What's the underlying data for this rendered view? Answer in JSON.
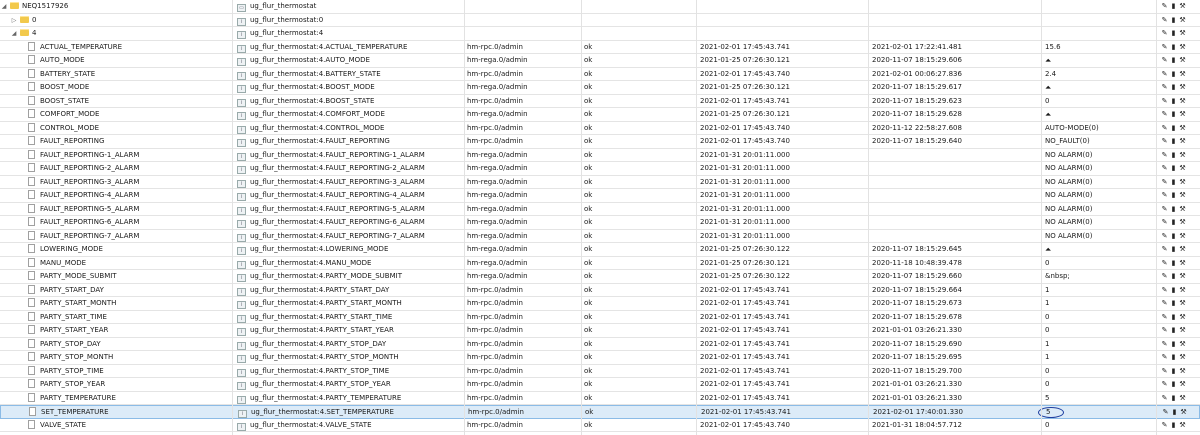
{
  "tree": {
    "root": {
      "name": "NEQ1517926",
      "title": "ug_flur_thermostat"
    },
    "channel0": {
      "name": "0",
      "title": "ug_flur_thermostat:0"
    },
    "channel4": {
      "name": "4",
      "title": "ug_flur_thermostat:4"
    },
    "states": [
      {
        "name": "ACTUAL_TEMPERATURE",
        "title": "ug_flur_thermostat:4.ACTUAL_TEMPERATURE",
        "role": "hm-rpc.0/admin",
        "ack": "ok",
        "ts": "2021-02-01 17:45:43.741",
        "lc": "2021-02-01 17:22:41.481",
        "value": "15.6"
      },
      {
        "name": "AUTO_MODE",
        "title": "ug_flur_thermostat:4.AUTO_MODE",
        "role": "hm-rega.0/admin",
        "ack": "ok",
        "ts": "2021-01-25 07:26:30.121",
        "lc": "2020-11-07 18:15:29.606",
        "value": "",
        "icon": "button-icon"
      },
      {
        "name": "BATTERY_STATE",
        "title": "ug_flur_thermostat:4.BATTERY_STATE",
        "role": "hm-rpc.0/admin",
        "ack": "ok",
        "ts": "2021-02-01 17:45:43.740",
        "lc": "2021-02-01 00:06:27.836",
        "value": "2.4"
      },
      {
        "name": "BOOST_MODE",
        "title": "ug_flur_thermostat:4.BOOST_MODE",
        "role": "hm-rega.0/admin",
        "ack": "ok",
        "ts": "2021-01-25 07:26:30.121",
        "lc": "2020-11-07 18:15:29.617",
        "value": "",
        "icon": "button-icon"
      },
      {
        "name": "BOOST_STATE",
        "title": "ug_flur_thermostat:4.BOOST_STATE",
        "role": "hm-rpc.0/admin",
        "ack": "ok",
        "ts": "2021-02-01 17:45:43.741",
        "lc": "2020-11-07 18:15:29.623",
        "value": "0"
      },
      {
        "name": "COMFORT_MODE",
        "title": "ug_flur_thermostat:4.COMFORT_MODE",
        "role": "hm-rega.0/admin",
        "ack": "ok",
        "ts": "2021-01-25 07:26:30.121",
        "lc": "2020-11-07 18:15:29.628",
        "value": "",
        "icon": "button-icon"
      },
      {
        "name": "CONTROL_MODE",
        "title": "ug_flur_thermostat:4.CONTROL_MODE",
        "role": "hm-rpc.0/admin",
        "ack": "ok",
        "ts": "2021-02-01 17:45:43.740",
        "lc": "2020-11-12 22:58:27.608",
        "value": "AUTO-MODE(0)"
      },
      {
        "name": "FAULT_REPORTING",
        "title": "ug_flur_thermostat:4.FAULT_REPORTING",
        "role": "hm-rpc.0/admin",
        "ack": "ok",
        "ts": "2021-02-01 17:45:43.740",
        "lc": "2020-11-07 18:15:29.640",
        "value": "NO_FAULT(0)"
      },
      {
        "name": "FAULT_REPORTING-1_ALARM",
        "title": "ug_flur_thermostat:4.FAULT_REPORTING-1_ALARM",
        "role": "hm-rega.0/admin",
        "ack": "ok",
        "ts": "2021-01-31 20:01:11.000",
        "lc": "",
        "value": "NO ALARM(0)"
      },
      {
        "name": "FAULT_REPORTING-2_ALARM",
        "title": "ug_flur_thermostat:4.FAULT_REPORTING-2_ALARM",
        "role": "hm-rega.0/admin",
        "ack": "ok",
        "ts": "2021-01-31 20:01:11.000",
        "lc": "",
        "value": "NO ALARM(0)"
      },
      {
        "name": "FAULT_REPORTING-3_ALARM",
        "title": "ug_flur_thermostat:4.FAULT_REPORTING-3_ALARM",
        "role": "hm-rega.0/admin",
        "ack": "ok",
        "ts": "2021-01-31 20:01:11.000",
        "lc": "",
        "value": "NO ALARM(0)"
      },
      {
        "name": "FAULT_REPORTING-4_ALARM",
        "title": "ug_flur_thermostat:4.FAULT_REPORTING-4_ALARM",
        "role": "hm-rega.0/admin",
        "ack": "ok",
        "ts": "2021-01-31 20:01:11.000",
        "lc": "",
        "value": "NO ALARM(0)"
      },
      {
        "name": "FAULT_REPORTING-5_ALARM",
        "title": "ug_flur_thermostat:4.FAULT_REPORTING-5_ALARM",
        "role": "hm-rega.0/admin",
        "ack": "ok",
        "ts": "2021-01-31 20:01:11.000",
        "lc": "",
        "value": "NO ALARM(0)"
      },
      {
        "name": "FAULT_REPORTING-6_ALARM",
        "title": "ug_flur_thermostat:4.FAULT_REPORTING-6_ALARM",
        "role": "hm-rega.0/admin",
        "ack": "ok",
        "ts": "2021-01-31 20:01:11.000",
        "lc": "",
        "value": "NO ALARM(0)"
      },
      {
        "name": "FAULT_REPORTING-7_ALARM",
        "title": "ug_flur_thermostat:4.FAULT_REPORTING-7_ALARM",
        "role": "hm-rega.0/admin",
        "ack": "ok",
        "ts": "2021-01-31 20:01:11.000",
        "lc": "",
        "value": "NO ALARM(0)"
      },
      {
        "name": "LOWERING_MODE",
        "title": "ug_flur_thermostat:4.LOWERING_MODE",
        "role": "hm-rega.0/admin",
        "ack": "ok",
        "ts": "2021-01-25 07:26:30.122",
        "lc": "2020-11-07 18:15:29.645",
        "value": "",
        "icon": "button-icon"
      },
      {
        "name": "MANU_MODE",
        "title": "ug_flur_thermostat:4.MANU_MODE",
        "role": "hm-rega.0/admin",
        "ack": "ok",
        "ts": "2021-01-25 07:26:30.121",
        "lc": "2020-11-18 10:48:39.478",
        "value": "0"
      },
      {
        "name": "PARTY_MODE_SUBMIT",
        "title": "ug_flur_thermostat:4.PARTY_MODE_SUBMIT",
        "role": "hm-rega.0/admin",
        "ack": "ok",
        "ts": "2021-01-25 07:26:30.122",
        "lc": "2020-11-07 18:15:29.660",
        "value": "&nbsp;"
      },
      {
        "name": "PARTY_START_DAY",
        "title": "ug_flur_thermostat:4.PARTY_START_DAY",
        "role": "hm-rpc.0/admin",
        "ack": "ok",
        "ts": "2021-02-01 17:45:43.741",
        "lc": "2020-11-07 18:15:29.664",
        "value": "1"
      },
      {
        "name": "PARTY_START_MONTH",
        "title": "ug_flur_thermostat:4.PARTY_START_MONTH",
        "role": "hm-rpc.0/admin",
        "ack": "ok",
        "ts": "2021-02-01 17:45:43.741",
        "lc": "2020-11-07 18:15:29.673",
        "value": "1"
      },
      {
        "name": "PARTY_START_TIME",
        "title": "ug_flur_thermostat:4.PARTY_START_TIME",
        "role": "hm-rpc.0/admin",
        "ack": "ok",
        "ts": "2021-02-01 17:45:43.741",
        "lc": "2020-11-07 18:15:29.678",
        "value": "0"
      },
      {
        "name": "PARTY_START_YEAR",
        "title": "ug_flur_thermostat:4.PARTY_START_YEAR",
        "role": "hm-rpc.0/admin",
        "ack": "ok",
        "ts": "2021-02-01 17:45:43.741",
        "lc": "2021-01-01 03:26:21.330",
        "value": "0"
      },
      {
        "name": "PARTY_STOP_DAY",
        "title": "ug_flur_thermostat:4.PARTY_STOP_DAY",
        "role": "hm-rpc.0/admin",
        "ack": "ok",
        "ts": "2021-02-01 17:45:43.741",
        "lc": "2020-11-07 18:15:29.690",
        "value": "1"
      },
      {
        "name": "PARTY_STOP_MONTH",
        "title": "ug_flur_thermostat:4.PARTY_STOP_MONTH",
        "role": "hm-rpc.0/admin",
        "ack": "ok",
        "ts": "2021-02-01 17:45:43.741",
        "lc": "2020-11-07 18:15:29.695",
        "value": "1"
      },
      {
        "name": "PARTY_STOP_TIME",
        "title": "ug_flur_thermostat:4.PARTY_STOP_TIME",
        "role": "hm-rpc.0/admin",
        "ack": "ok",
        "ts": "2021-02-01 17:45:43.741",
        "lc": "2020-11-07 18:15:29.700",
        "value": "0"
      },
      {
        "name": "PARTY_STOP_YEAR",
        "title": "ug_flur_thermostat:4.PARTY_STOP_YEAR",
        "role": "hm-rpc.0/admin",
        "ack": "ok",
        "ts": "2021-02-01 17:45:43.741",
        "lc": "2021-01-01 03:26:21.330",
        "value": "0"
      },
      {
        "name": "PARTY_TEMPERATURE",
        "title": "ug_flur_thermostat:4.PARTY_TEMPERATURE",
        "role": "hm-rpc.0/admin",
        "ack": "ok",
        "ts": "2021-02-01 17:45:43.741",
        "lc": "2021-01-01 03:26:21.330",
        "value": "5"
      },
      {
        "name": "SET_TEMPERATURE",
        "title": "ug_flur_thermostat:4.SET_TEMPERATURE",
        "role": "hm-rpc.0/admin",
        "ack": "ok",
        "ts": "2021-02-01 17:45:43.741",
        "lc": "2021-02-01 17:40:01.330",
        "value": "5",
        "selected": true
      },
      {
        "name": "VALVE_STATE",
        "title": "ug_flur_thermostat:4.VALVE_STATE",
        "role": "hm-rpc.0/admin",
        "ack": "ok",
        "ts": "2021-02-01 17:45:43.740",
        "lc": "2021-01-31 18:04:57.712",
        "value": "0"
      }
    ]
  },
  "icons": {
    "edit": "pencil-icon",
    "delete": "trash-icon",
    "settings": "wrench-icon",
    "value_button": "bell-button-icon"
  },
  "colors": {
    "selected_row": "#dcebf8",
    "annotation_circle": "#1f3fa0",
    "folder": "#f2c94c"
  }
}
